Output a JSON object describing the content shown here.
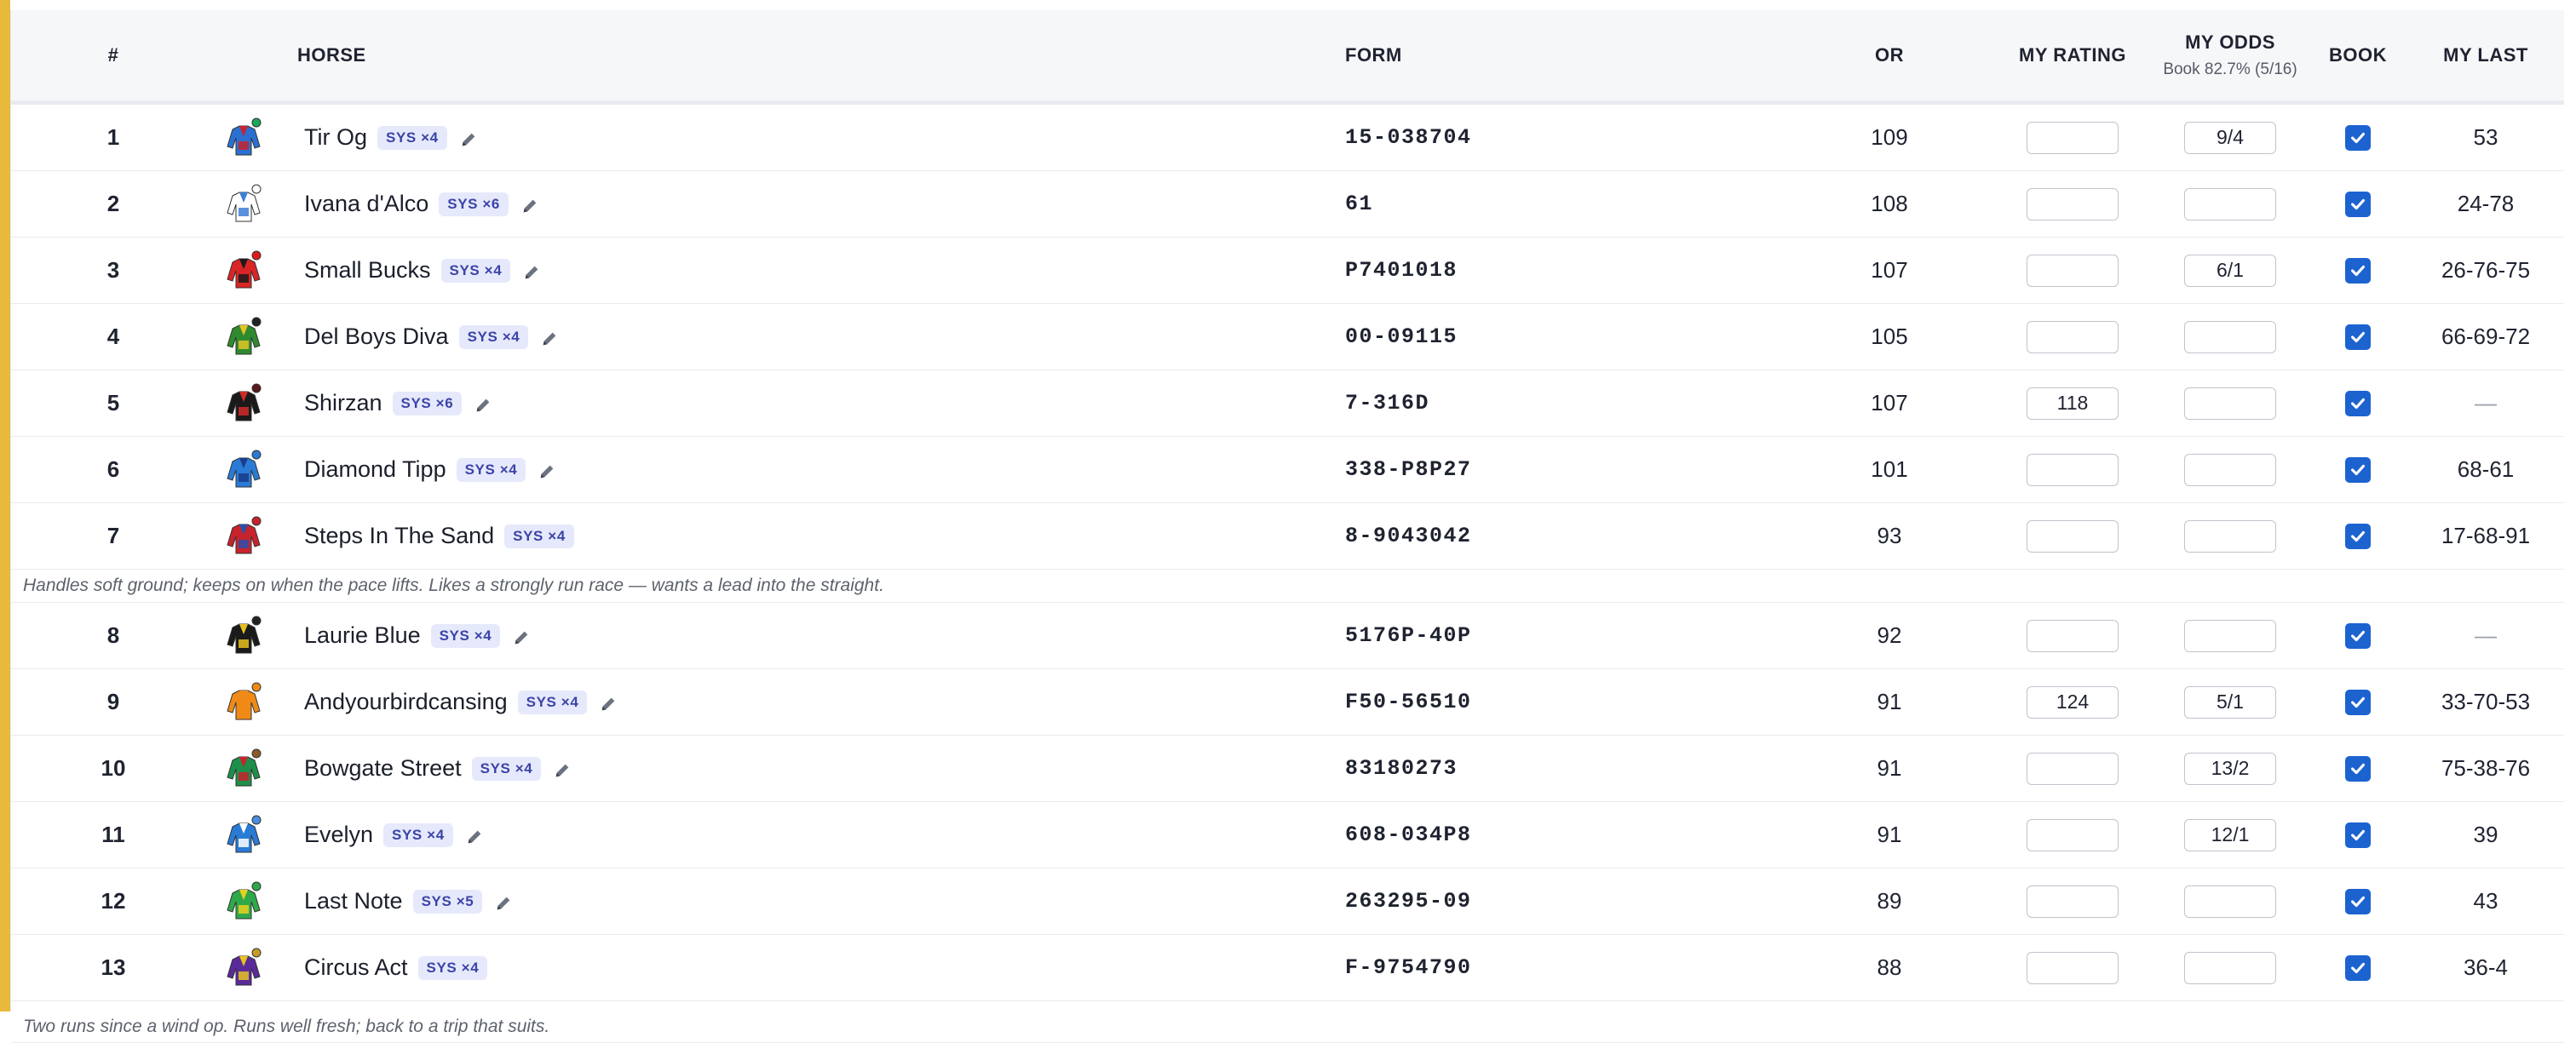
{
  "colors": {
    "accent_bar": "#e8b93a",
    "badge_bg": "#e6e9fb",
    "badge_text": "#3b44a8",
    "checkbox": "#1c63d0"
  },
  "headers": {
    "num": "#",
    "horse": "HORSE",
    "form": "FORM",
    "or": "OR",
    "my_rating": "MY RATING",
    "my_odds": "MY ODDS",
    "my_odds_sub": "Book 82.7% (5/16)",
    "book": "BOOK",
    "my_last": "MY LAST"
  },
  "runners": [
    {
      "num": "1",
      "name": "Tir Og",
      "sys": "SYS ×4",
      "form": "15-038704",
      "or": "109",
      "rating": "",
      "odds": "9/4",
      "book": true,
      "last": "53",
      "silk_colors": [
        "#2b6fd1",
        "#c8232c"
      ],
      "cap": "#1aa85a",
      "pencil": true
    },
    {
      "num": "2",
      "name": "Ivana d'Alco",
      "sys": "SYS ×6",
      "form": "61",
      "or": "108",
      "rating": "",
      "odds": "",
      "book": true,
      "last": "24-78",
      "silk_colors": [
        "#ffffff",
        "#3c7fd6"
      ],
      "cap": "#ffffff",
      "pencil": true
    },
    {
      "num": "3",
      "name": "Small Bucks",
      "sys": "SYS ×4",
      "form": "P7401018",
      "or": "107",
      "rating": "",
      "odds": "6/1",
      "book": true,
      "last": "26-76-75",
      "silk_colors": [
        "#d92525",
        "#1a1a1a"
      ],
      "cap": "#e01b1b",
      "pencil": true
    },
    {
      "num": "4",
      "name": "Del Boys Diva",
      "sys": "SYS ×4",
      "form": "00-09115",
      "or": "105",
      "rating": "",
      "odds": "",
      "book": true,
      "last": "66-69-72",
      "silk_colors": [
        "#2f8a2f",
        "#e3c526"
      ],
      "cap": "#222222",
      "pencil": true
    },
    {
      "num": "5",
      "name": "Shirzan",
      "sys": "SYS ×6",
      "form": "7-316D",
      "or": "107",
      "rating": "118",
      "odds": "",
      "book": true,
      "last": "—",
      "silk_colors": [
        "#1a1a1a",
        "#d12a2a"
      ],
      "cap": "#5a1a1a",
      "pencil": true
    },
    {
      "num": "6",
      "name": "Diamond Tipp",
      "sys": "SYS ×4",
      "form": "338-P8P27",
      "or": "101",
      "rating": "",
      "odds": "",
      "book": true,
      "last": "68-61",
      "silk_colors": [
        "#2a7bd6",
        "#1b3c8a"
      ],
      "cap": "#2a7bd6",
      "pencil": true
    },
    {
      "num": "7",
      "name": "Steps In The Sand",
      "sys": "SYS ×4",
      "form": "8-9043042",
      "or": "93",
      "rating": "",
      "odds": "",
      "book": true,
      "last": "17-68-91",
      "silk_colors": [
        "#c8232c",
        "#2b4fae"
      ],
      "cap": "#c8232c",
      "pencil": false,
      "note": "Handles soft ground; keeps on when the pace lifts. Likes a strongly run race — wants a lead into the straight."
    },
    {
      "num": "8",
      "name": "Laurie Blue",
      "sys": "SYS ×4",
      "form": "5176P-40P",
      "or": "92",
      "rating": "",
      "odds": "",
      "book": true,
      "last": "—",
      "silk_colors": [
        "#1a1a1a",
        "#e6c21f"
      ],
      "cap": "#222222",
      "pencil": true
    },
    {
      "num": "9",
      "name": "Andyourbirdcansing",
      "sys": "SYS ×4",
      "form": "F50-56510",
      "or": "91",
      "rating": "124",
      "odds": "5/1",
      "book": true,
      "last": "33-70-53",
      "silk_colors": [
        "#ef8a17",
        "#ef8a17"
      ],
      "cap": "#ef8a17",
      "pencil": true
    },
    {
      "num": "10",
      "name": "Bowgate Street",
      "sys": "SYS ×4",
      "form": "83180273",
      "or": "91",
      "rating": "",
      "odds": "13/2",
      "book": true,
      "last": "75-38-76",
      "silk_colors": [
        "#1e8f4a",
        "#c8232c"
      ],
      "cap": "#8a5a2a",
      "pencil": true
    },
    {
      "num": "11",
      "name": "Evelyn",
      "sys": "SYS ×4",
      "form": "608-034P8",
      "or": "91",
      "rating": "",
      "odds": "12/1",
      "book": true,
      "last": "39",
      "silk_colors": [
        "#2a7bd6",
        "#ffffff"
      ],
      "cap": "#4a8fe0",
      "pencil": true
    },
    {
      "num": "12",
      "name": "Last Note",
      "sys": "SYS ×5",
      "form": "263295-09",
      "or": "89",
      "rating": "",
      "odds": "",
      "book": true,
      "last": "43",
      "silk_colors": [
        "#2fa84a",
        "#e8d21f"
      ],
      "cap": "#2fa84a",
      "pencil": true
    },
    {
      "num": "13",
      "name": "Circus Act",
      "sys": "SYS ×4",
      "form": "F-9754790",
      "or": "88",
      "rating": "",
      "odds": "",
      "book": true,
      "last": "36-4",
      "silk_colors": [
        "#5a2a9a",
        "#e8c21f"
      ],
      "cap": "#c89a2a",
      "pencil": false,
      "note": "Two runs since a wind op. Runs well fresh; back to a trip that suits."
    }
  ]
}
